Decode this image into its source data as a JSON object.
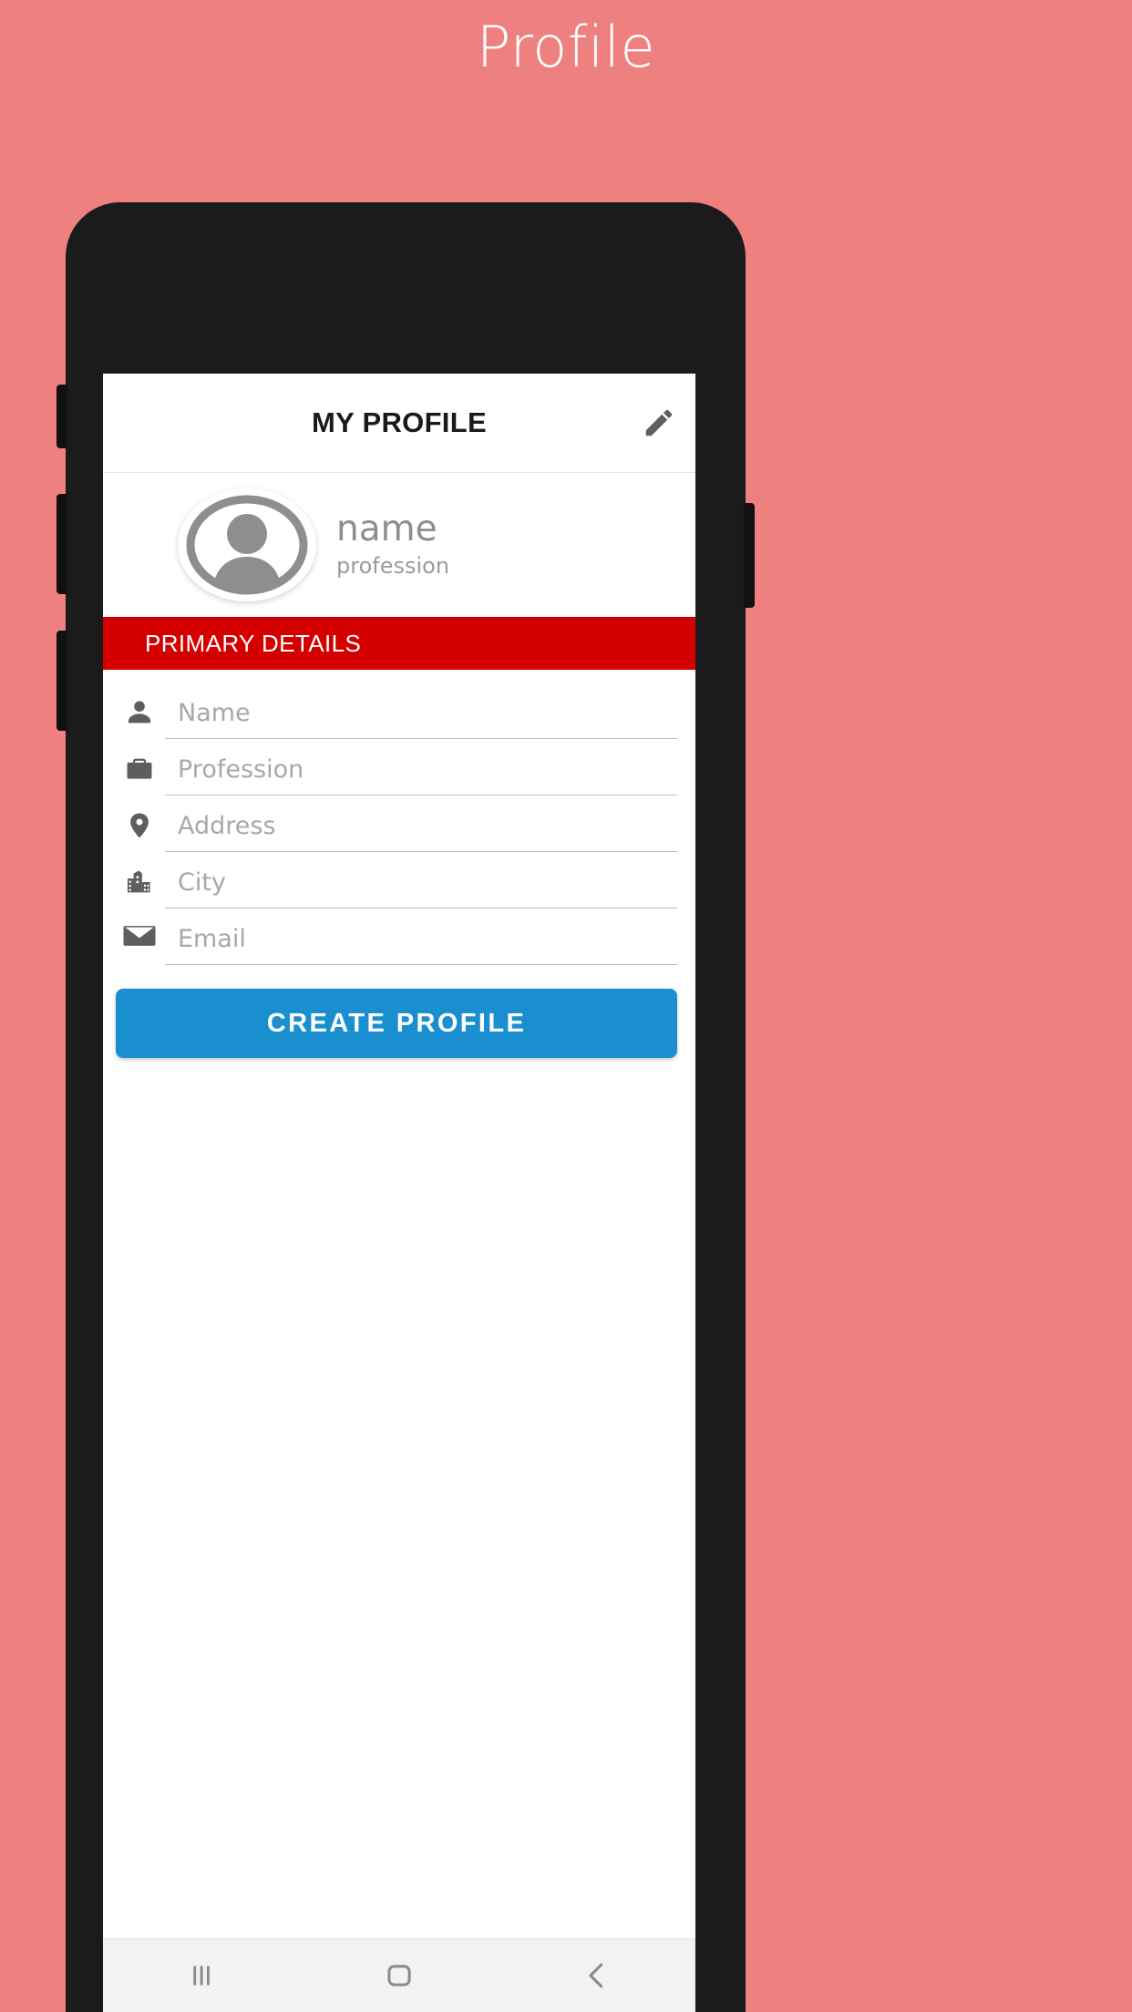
{
  "page": {
    "title": "Profile",
    "background_color": "#ef8080",
    "title_color": "#ffffff"
  },
  "device": {
    "body_color": "#1b1b1b",
    "screen_background": "#ffffff"
  },
  "appbar": {
    "title": "MY PROFILE",
    "edit_icon": "pencil-icon",
    "title_color": "#1a1a1a",
    "icon_color": "#5e5e5e"
  },
  "profile_card": {
    "avatar_icon": "person-placeholder-icon",
    "name": "name",
    "profession": "profession",
    "text_color": "#8e8e8e"
  },
  "section": {
    "label": "PRIMARY DETAILS",
    "background_color": "#d40000",
    "text_color": "#ffffff"
  },
  "form": {
    "fields": [
      {
        "icon": "person-icon",
        "placeholder": "Name",
        "value": ""
      },
      {
        "icon": "briefcase-icon",
        "placeholder": "Profession",
        "value": ""
      },
      {
        "icon": "location-pin-icon",
        "placeholder": "Address",
        "value": ""
      },
      {
        "icon": "city-building-icon",
        "placeholder": "City",
        "value": ""
      },
      {
        "icon": "envelope-icon",
        "placeholder": "Email",
        "value": ""
      }
    ]
  },
  "cta": {
    "label": "CREATE PROFILE",
    "background_color": "#1a8fd0",
    "text_color": "#ffffff"
  },
  "navbar": {
    "background_color": "#f2f2f2",
    "icon_color": "#8a8a8a",
    "buttons": [
      {
        "name": "recents-icon",
        "label": "Recents"
      },
      {
        "name": "home-icon",
        "label": "Home"
      },
      {
        "name": "back-icon",
        "label": "Back"
      }
    ]
  }
}
